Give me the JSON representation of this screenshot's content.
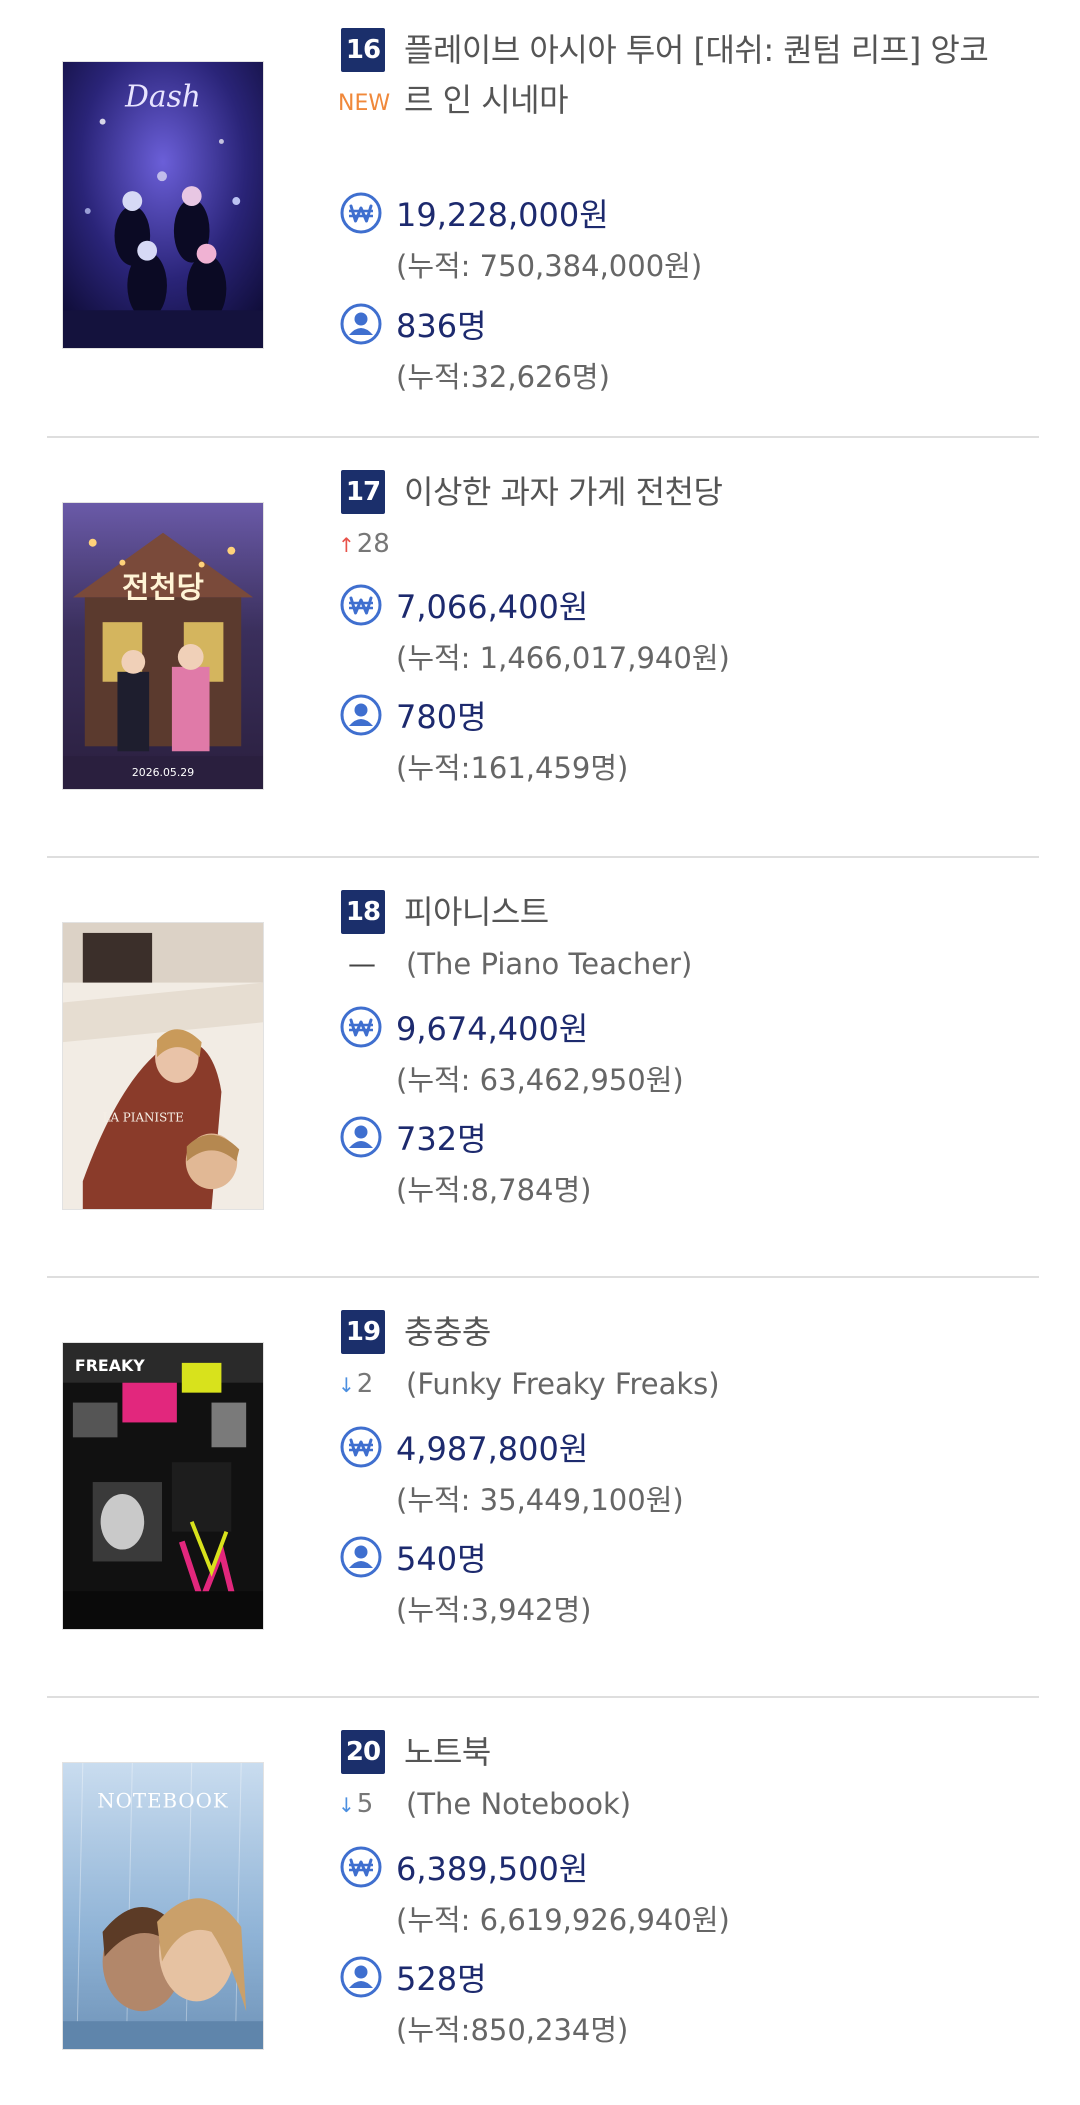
{
  "items": [
    {
      "rank": "16",
      "title": "플레이브 아시아 투어 [대쉬: 퀀텀 리프] 앙코르 인 시네마",
      "change": "NEW",
      "original_title": "",
      "revenue": "19,228,000원",
      "revenue_cumulative": "(누적: 750,384,000원)",
      "audience": "836명",
      "audience_cumulative": "(누적:32,626명)",
      "poster_title": "Dash",
      "poster_colors": [
        "#1c1a55",
        "#5a48c9",
        "#e8e4ff"
      ]
    },
    {
      "rank": "17",
      "title": "이상한 과자 가게 전천당",
      "change": "28",
      "change_direction": "up",
      "original_title": "",
      "revenue": "7,066,400원",
      "revenue_cumulative": "(누적: 1,466,017,940원)",
      "audience": "780명",
      "audience_cumulative": "(누적:161,459명)",
      "poster_title": "전천당",
      "poster_subtitle": "2026.05.29",
      "poster_colors": [
        "#3a2f5c",
        "#c25c8a",
        "#f3d56a"
      ]
    },
    {
      "rank": "18",
      "title": "피아니스트",
      "change": "",
      "change_direction": "same",
      "original_title": "(The Piano Teacher)",
      "revenue": "9,674,400원",
      "revenue_cumulative": "(누적: 63,462,950원)",
      "audience": "732명",
      "audience_cumulative": "(누적:8,784명)",
      "poster_title": "LA PIANISTE",
      "poster_colors": [
        "#f2ece4",
        "#8a3b2a",
        "#2b2522"
      ]
    },
    {
      "rank": "19",
      "title": "충충충",
      "change": "2",
      "change_direction": "down",
      "original_title": "(Funky Freaky Freaks)",
      "revenue": "4,987,800원",
      "revenue_cumulative": "(누적: 35,449,100원)",
      "audience": "540명",
      "audience_cumulative": "(누적:3,942명)",
      "poster_title": "FREAKY",
      "poster_colors": [
        "#111111",
        "#e2277d",
        "#d8e21c"
      ]
    },
    {
      "rank": "20",
      "title": "노트북",
      "change": "5",
      "change_direction": "down",
      "original_title": "(The Notebook)",
      "revenue": "6,389,500원",
      "revenue_cumulative": "(누적: 6,619,926,940원)",
      "audience": "528명",
      "audience_cumulative": "(누적:850,234명)",
      "poster_title": "NOTEBOOK",
      "poster_colors": [
        "#8fb3d6",
        "#c9dcef",
        "#b2876a"
      ]
    }
  ],
  "icons": {
    "revenue": "won-icon",
    "audience": "person-icon",
    "up": "arrow-up-icon",
    "down": "arrow-down-icon"
  },
  "colors": {
    "rank_badge": "#1b2f6b",
    "value_text": "#1d2a6e",
    "icon": "#3f6fcf",
    "new_badge": "#f0883a",
    "up_arrow": "#e8524a",
    "down_arrow": "#4c8fe0"
  }
}
